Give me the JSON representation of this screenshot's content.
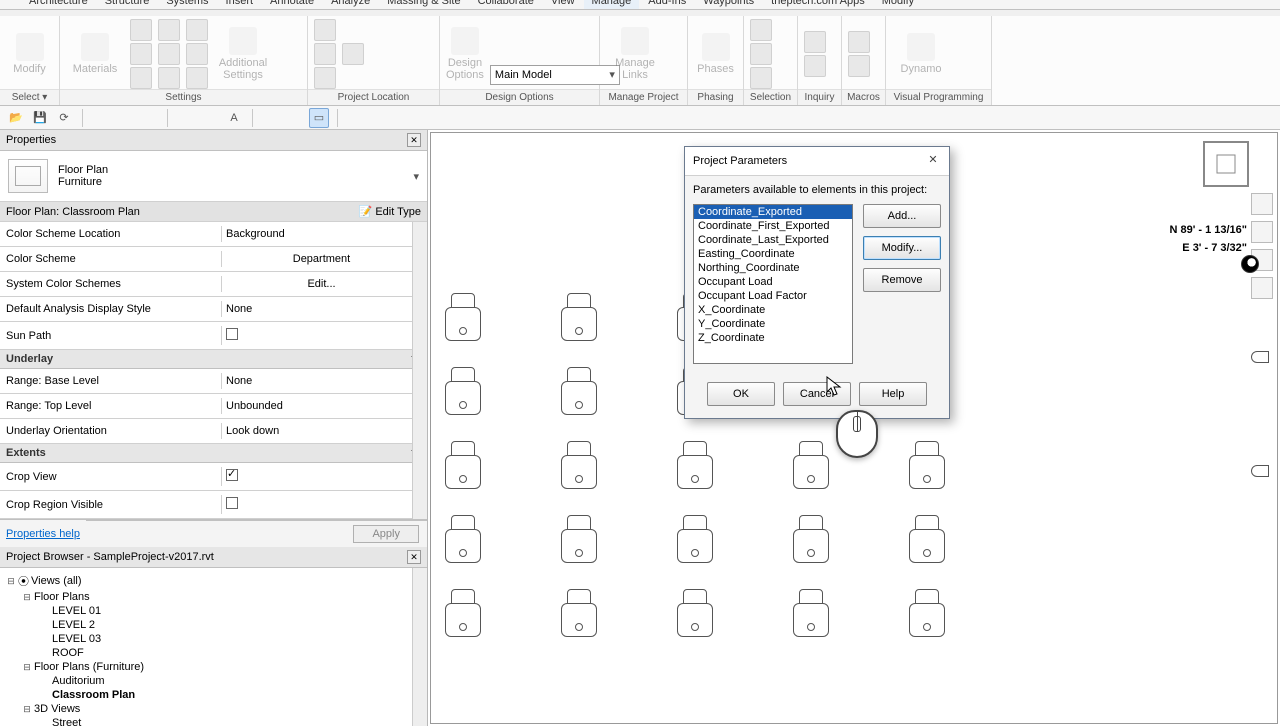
{
  "menubar": [
    "",
    "Architecture",
    "Structure",
    "Systems",
    "Insert",
    "Annotate",
    "Analyze",
    "Massing & Site",
    "Collaborate",
    "View",
    "Manage",
    "Add-Ins",
    "Waypoints",
    "theptech.com Apps",
    "Modify"
  ],
  "menubar_active": 10,
  "ribbon": {
    "modify": "Modify",
    "materials": "Materials",
    "additional_settings": "Additional\nSettings",
    "design_options": "Design\nOptions",
    "main_model": "Main Model",
    "manage_links": "Manage\nLinks",
    "phases": "Phases",
    "dynamo": "Dynamo",
    "groups": [
      "Select ▾",
      "Settings",
      "Project Location",
      "Design Options",
      "Manage Project",
      "Phasing",
      "Selection",
      "Inquiry",
      "Macros",
      "Visual Programming"
    ]
  },
  "properties": {
    "title": "Properties",
    "type_major": "Floor Plan",
    "type_minor": "Furniture",
    "instance_label": "Floor Plan: Classroom Plan",
    "edit_type": "Edit Type",
    "rows": [
      {
        "label": "Color Scheme Location",
        "value": "Background"
      },
      {
        "label": "Color Scheme",
        "value": "Department",
        "center": true
      },
      {
        "label": "System Color Schemes",
        "value": "Edit...",
        "center": true
      },
      {
        "label": "Default Analysis Display Style",
        "value": "None"
      },
      {
        "label": "Sun Path",
        "checkbox": false
      }
    ],
    "sect_underlay": "Underlay",
    "underlay_rows": [
      {
        "label": "Range: Base Level",
        "value": "None"
      },
      {
        "label": "Range: Top Level",
        "value": "Unbounded"
      },
      {
        "label": "Underlay Orientation",
        "value": "Look down"
      }
    ],
    "sect_extents": "Extents",
    "extents_rows": [
      {
        "label": "Crop View",
        "checkbox": true
      },
      {
        "label": "Crop Region Visible",
        "checkbox": false
      }
    ],
    "help": "Properties help",
    "apply": "Apply"
  },
  "browser": {
    "title": "Project Browser - SampleProject-v2017.rvt",
    "root": "Views (all)",
    "floor_plans": "Floor Plans",
    "levels": [
      "LEVEL 01",
      "LEVEL 2",
      "LEVEL 03",
      "ROOF"
    ],
    "fp_furniture": "Floor Plans (Furniture)",
    "fp_items": [
      "Auditorium",
      "Classroom Plan"
    ],
    "threeD": "3D Views",
    "threeD_items": [
      "Street"
    ]
  },
  "dialog": {
    "title": "Project Parameters",
    "desc": "Parameters available to elements in this project:",
    "items": [
      "Coordinate_Exported",
      "Coordinate_First_Exported",
      "Coordinate_Last_Exported",
      "Easting_Coordinate",
      "Northing_Coordinate",
      "Occupant Load",
      "Occupant Load Factor",
      "X_Coordinate",
      "Y_Coordinate",
      "Z_Coordinate"
    ],
    "add": "Add...",
    "modify": "Modify...",
    "remove": "Remove",
    "ok": "OK",
    "cancel": "Cancel",
    "help_btn": "Help"
  },
  "canvas": {
    "coord1": "N 89' - 1 13/16\"",
    "coord2": "E 3' - 7 3/32\""
  }
}
